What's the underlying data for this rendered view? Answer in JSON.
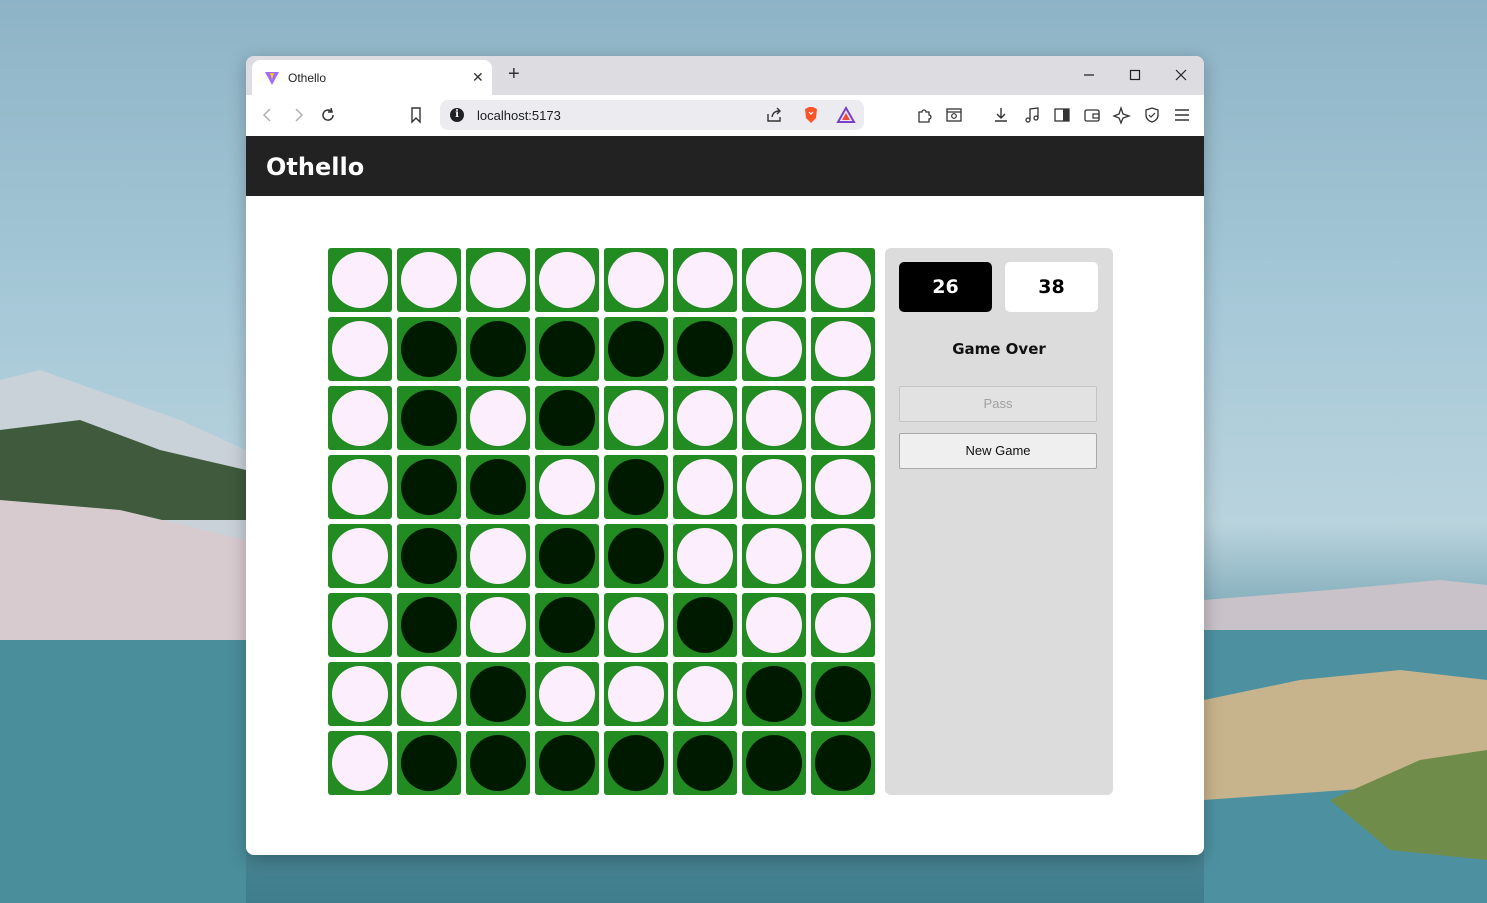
{
  "browser": {
    "tab_title": "Othello",
    "new_tab_symbol": "+",
    "close_tab_symbol": "✕",
    "url": "localhost:5173",
    "info_symbol": "i"
  },
  "app": {
    "title": "Othello"
  },
  "board": [
    [
      "W",
      "W",
      "W",
      "W",
      "W",
      "W",
      "W",
      "W"
    ],
    [
      "W",
      "B",
      "B",
      "B",
      "B",
      "B",
      "W",
      "W"
    ],
    [
      "W",
      "B",
      "W",
      "B",
      "W",
      "W",
      "W",
      "W"
    ],
    [
      "W",
      "B",
      "B",
      "W",
      "B",
      "W",
      "W",
      "W"
    ],
    [
      "W",
      "B",
      "W",
      "B",
      "B",
      "W",
      "W",
      "W"
    ],
    [
      "W",
      "B",
      "W",
      "B",
      "W",
      "B",
      "W",
      "W"
    ],
    [
      "W",
      "W",
      "B",
      "W",
      "W",
      "W",
      "B",
      "B"
    ],
    [
      "W",
      "B",
      "B",
      "B",
      "B",
      "B",
      "B",
      "B"
    ]
  ],
  "colors": {
    "board_green": "#228b22",
    "white_disc": "#fceefc",
    "black_disc": "#001a00",
    "app_bar": "#222222",
    "panel": "#dcdcdc"
  },
  "scores": {
    "black": "26",
    "white": "38"
  },
  "status": "Game Over",
  "buttons": {
    "pass": "Pass",
    "new_game": "New Game"
  }
}
